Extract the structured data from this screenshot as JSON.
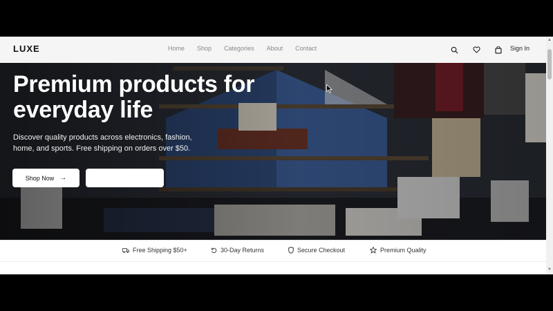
{
  "header": {
    "logo": "LUXE",
    "nav": [
      "Home",
      "Shop",
      "Categories",
      "About",
      "Contact"
    ],
    "icons": [
      "search-icon",
      "heart-icon",
      "bag-icon"
    ],
    "sign_in": "Sign In"
  },
  "hero": {
    "title": "Premium products for everyday life",
    "subtitle": "Discover quality products across electronics, fashion, home, and sports. Free shipping on orders over $50.",
    "primary_button": "Shop Now",
    "secondary_button": ""
  },
  "features": [
    {
      "icon": "truck-icon",
      "label": "Free Shipping $50+"
    },
    {
      "icon": "return-icon",
      "label": "30-Day Returns"
    },
    {
      "icon": "shield-icon",
      "label": "Secure Checkout"
    },
    {
      "icon": "star-icon",
      "label": "Premium Quality"
    }
  ],
  "colors": {
    "accent": "#111111",
    "hero_overlay": "#2c3340"
  }
}
